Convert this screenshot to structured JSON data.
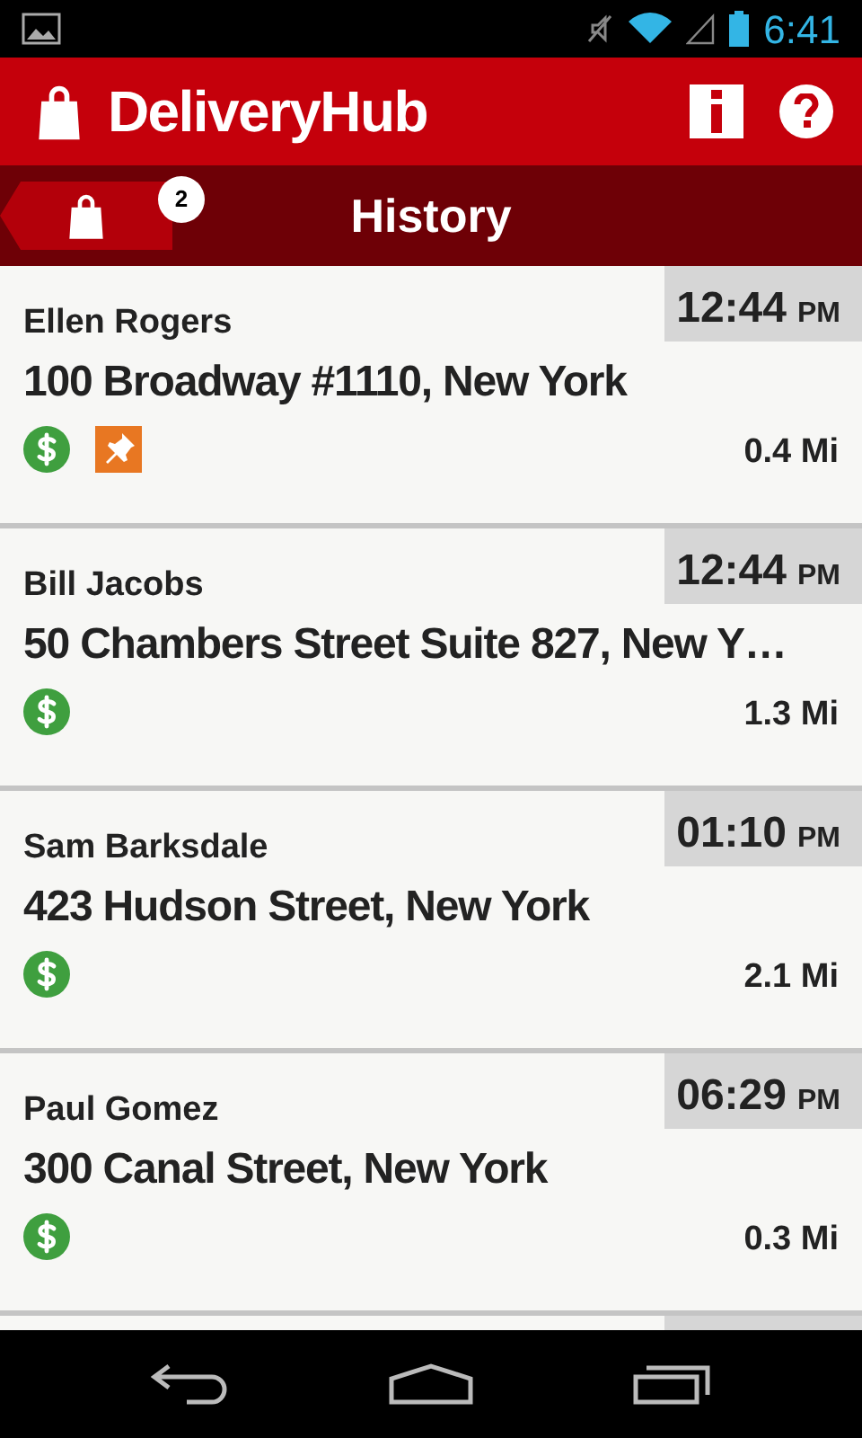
{
  "status_bar": {
    "time": "6:41"
  },
  "app_bar": {
    "title": "DeliveryHub"
  },
  "sub_bar": {
    "cart_count": "2",
    "title": "History"
  },
  "deliveries": [
    {
      "name": "Ellen Rogers",
      "time": "12:44",
      "ampm": "PM",
      "address": "100 Broadway #1110, New York",
      "distance": "0.4 Mi",
      "badges": [
        {
          "kind": "cash"
        },
        {
          "kind": "pin"
        }
      ]
    },
    {
      "name": "Bill Jacobs",
      "time": "12:44",
      "ampm": "PM",
      "address": "50 Chambers Street Suite 827, New Y…",
      "distance": "1.3 Mi",
      "badges": [
        {
          "kind": "cash"
        }
      ]
    },
    {
      "name": "Sam Barksdale",
      "time": "01:10",
      "ampm": "PM",
      "address": "423 Hudson Street, New York",
      "distance": "2.1 Mi",
      "badges": [
        {
          "kind": "cash"
        }
      ]
    },
    {
      "name": "Paul Gomez",
      "time": "06:29",
      "ampm": "PM",
      "address": "300 Canal Street, New York",
      "distance": "0.3 Mi",
      "badges": [
        {
          "kind": "cash"
        }
      ]
    }
  ]
}
